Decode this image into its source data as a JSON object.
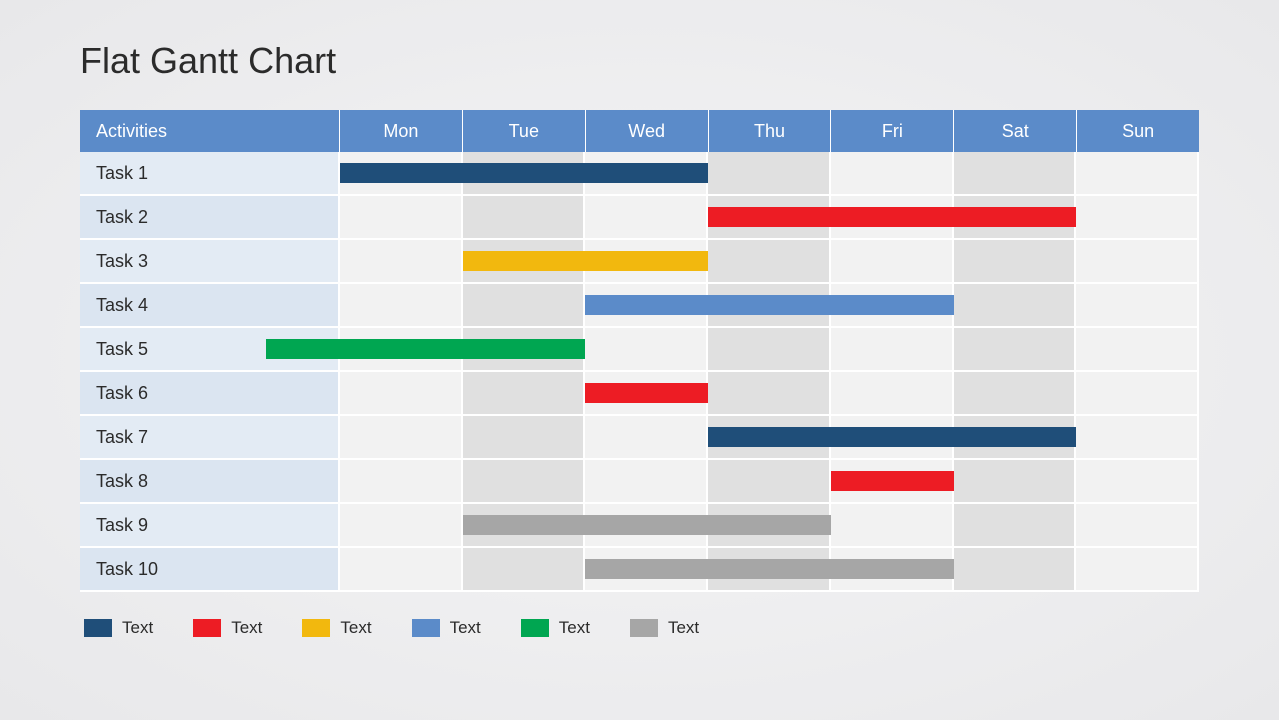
{
  "title": "Flat Gantt Chart",
  "header": {
    "activities_label": "Activities",
    "days": [
      "Mon",
      "Tue",
      "Wed",
      "Thu",
      "Fri",
      "Sat",
      "Sun"
    ]
  },
  "tasks": [
    {
      "label": "Task 1"
    },
    {
      "label": "Task 2"
    },
    {
      "label": "Task 3"
    },
    {
      "label": "Task 4"
    },
    {
      "label": "Task 5"
    },
    {
      "label": "Task 6"
    },
    {
      "label": "Task 7"
    },
    {
      "label": "Task 8"
    },
    {
      "label": "Task 9"
    },
    {
      "label": "Task 10"
    }
  ],
  "legend": [
    {
      "color": "#1f4e79",
      "label": "Text"
    },
    {
      "color": "#ed1c24",
      "label": "Text"
    },
    {
      "color": "#f2b80e",
      "label": "Text"
    },
    {
      "color": "#5b8bc9",
      "label": "Text"
    },
    {
      "color": "#00a651",
      "label": "Text"
    },
    {
      "color": "#a6a6a6",
      "label": "Text"
    }
  ],
  "colors": {
    "darkblue": "#1f4e79",
    "red": "#ed1c24",
    "yellow": "#f2b80e",
    "lightblue": "#5b8bc9",
    "green": "#00a651",
    "grey": "#a6a6a6"
  },
  "chart_data": {
    "type": "bar",
    "title": "Flat Gantt Chart",
    "xlabel": "",
    "ylabel": "",
    "categories": [
      "Mon",
      "Tue",
      "Wed",
      "Thu",
      "Fri",
      "Sat",
      "Sun"
    ],
    "series": [
      {
        "name": "Task 1",
        "start_day": 0,
        "end_day": 3,
        "color": "#1f4e79"
      },
      {
        "name": "Task 2",
        "start_day": 3,
        "end_day": 6,
        "color": "#ed1c24"
      },
      {
        "name": "Task 3",
        "start_day": 1,
        "end_day": 3,
        "color": "#f2b80e"
      },
      {
        "name": "Task 4",
        "start_day": 2,
        "end_day": 5,
        "color": "#5b8bc9"
      },
      {
        "name": "Task 5",
        "start_day": -0.6,
        "end_day": 2,
        "color": "#00a651"
      },
      {
        "name": "Task 6",
        "start_day": 2,
        "end_day": 3,
        "color": "#ed1c24"
      },
      {
        "name": "Task 7",
        "start_day": 3,
        "end_day": 6,
        "color": "#1f4e79"
      },
      {
        "name": "Task 8",
        "start_day": 4,
        "end_day": 5,
        "color": "#ed1c24"
      },
      {
        "name": "Task 9",
        "start_day": 1,
        "end_day": 4,
        "color": "#a6a6a6"
      },
      {
        "name": "Task 10",
        "start_day": 2,
        "end_day": 5,
        "color": "#a6a6a6"
      }
    ],
    "xlim": [
      0,
      7
    ]
  }
}
